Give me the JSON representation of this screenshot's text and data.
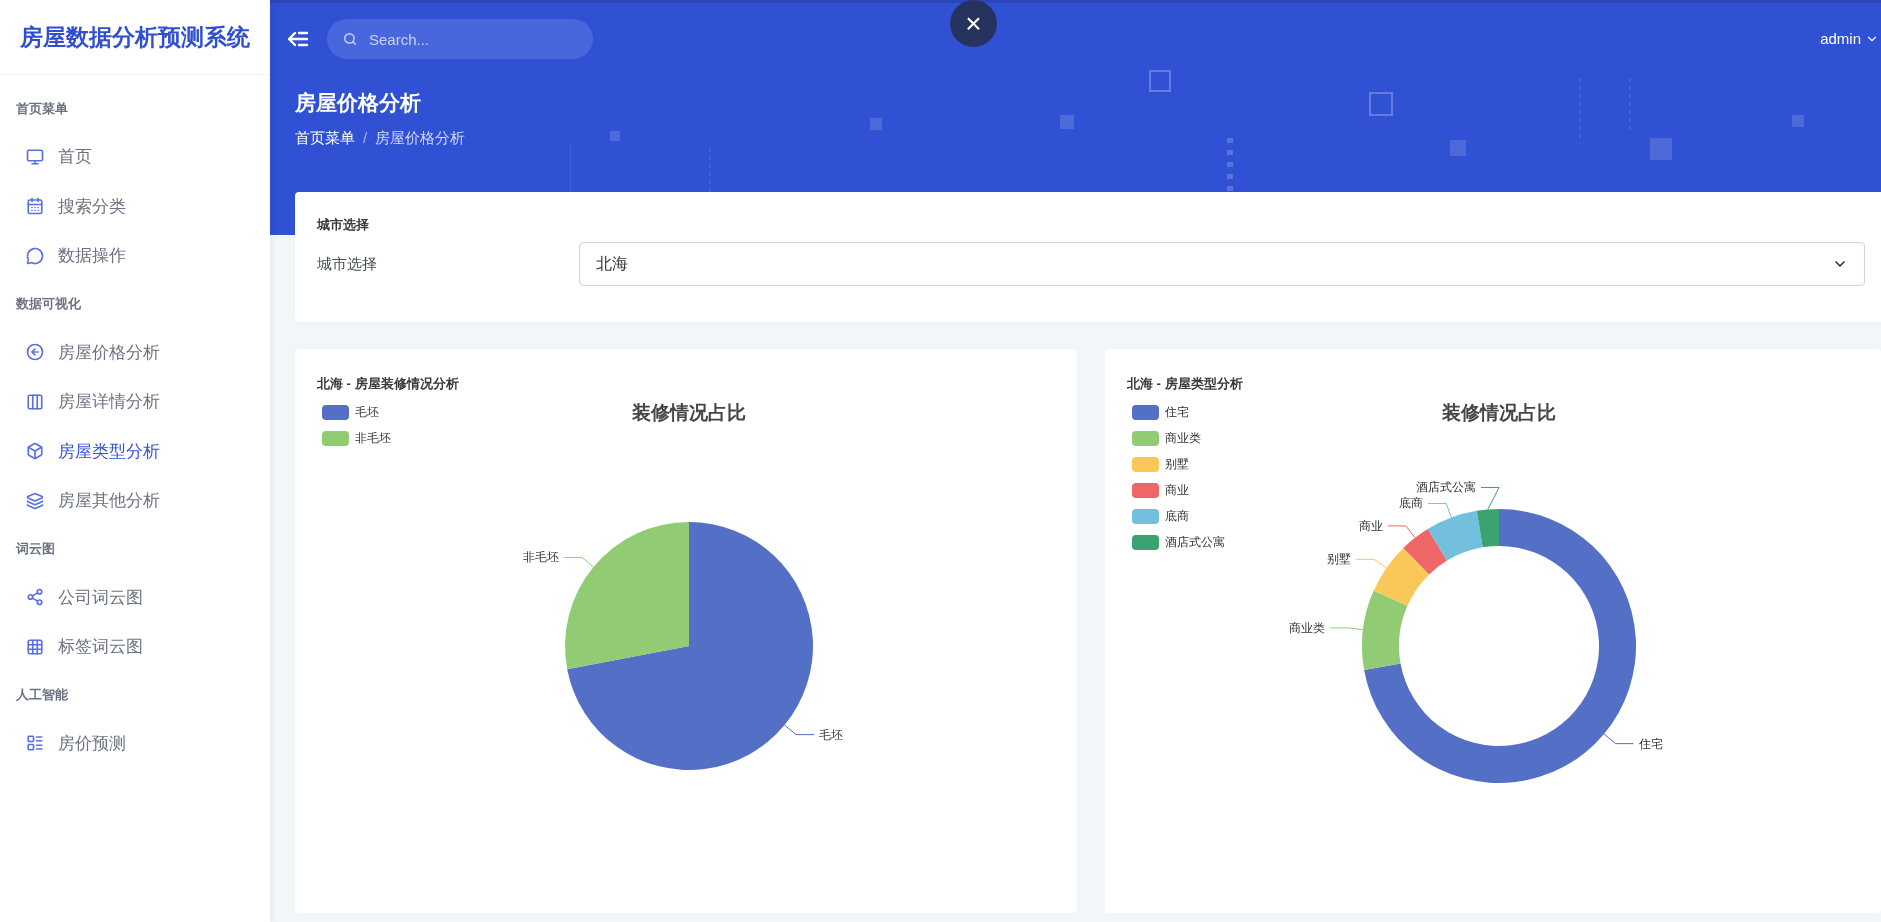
{
  "sidebar": {
    "brand": "房屋数据分析预测系统",
    "sections": [
      {
        "heading": "首页菜单",
        "items": [
          {
            "label": "首页",
            "selected": false
          },
          {
            "label": "搜索分类",
            "selected": false
          },
          {
            "label": "数据操作",
            "selected": false
          }
        ]
      },
      {
        "heading": "数据可视化",
        "items": [
          {
            "label": "房屋价格分析",
            "selected": false
          },
          {
            "label": "房屋详情分析",
            "selected": false
          },
          {
            "label": "房屋类型分析",
            "selected": true
          },
          {
            "label": "房屋其他分析",
            "selected": false
          }
        ]
      },
      {
        "heading": "词云图",
        "items": [
          {
            "label": "公司词云图",
            "selected": false
          },
          {
            "label": "标签词云图",
            "selected": false
          }
        ]
      },
      {
        "heading": "人工智能",
        "items": [
          {
            "label": "房价预测",
            "selected": false
          }
        ]
      }
    ]
  },
  "topbar": {
    "search": {
      "placeholder": "Search..."
    },
    "close": "×",
    "user": "admin"
  },
  "page_header": {
    "title": "房屋价格分析",
    "breadcrumb": {
      "items": [
        "首页菜单",
        "房屋价格分析"
      ],
      "separator": "/"
    }
  },
  "city_card": {
    "title": "城市选择",
    "label": "城市选择",
    "value": "北海"
  },
  "charts": [
    {
      "card_title": "北海 - 房屋装修情况分析",
      "legend": [
        {
          "label": "毛坯",
          "color": "#5470c6"
        },
        {
          "label": "非毛坯",
          "color": "#91cc75"
        }
      ],
      "chart_data": {
        "type": "pie",
        "title": "装修情况占比",
        "categories": [
          "毛坯",
          "非毛坯"
        ],
        "values": [
          72,
          28
        ]
      }
    },
    {
      "card_title": "北海 - 房屋类型分析",
      "legend": [
        {
          "label": "住宅",
          "color": "#5470c6"
        },
        {
          "label": "商业类",
          "color": "#91cc75"
        },
        {
          "label": "别墅",
          "color": "#fac858"
        },
        {
          "label": "商业",
          "color": "#ee6666"
        },
        {
          "label": "底商",
          "color": "#73c0de"
        },
        {
          "label": "酒店式公寓",
          "color": "#3ba272"
        }
      ],
      "chart_data": {
        "type": "donut",
        "title": "装修情况占比",
        "categories": [
          "住宅",
          "商业类",
          "别墅",
          "商业",
          "底商",
          "酒店式公寓"
        ],
        "values": [
          72.2,
          9.4,
          6.1,
          3.6,
          6.1,
          2.6
        ]
      }
    }
  ]
}
